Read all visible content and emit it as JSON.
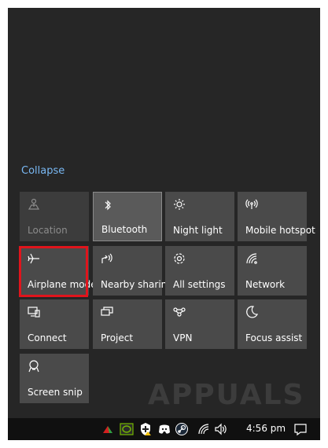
{
  "action_center": {
    "collapse_label": "Collapse",
    "tiles": [
      {
        "label": "Location",
        "icon": "location-icon",
        "state": "disabled"
      },
      {
        "label": "Bluetooth",
        "icon": "bluetooth-icon",
        "state": "on"
      },
      {
        "label": "Night light",
        "icon": "night-light-icon",
        "state": "off"
      },
      {
        "label": "Mobile hotspot",
        "icon": "mobile-hotspot-icon",
        "state": "off"
      },
      {
        "label": "Airplane mode",
        "icon": "airplane-icon",
        "state": "off"
      },
      {
        "label": "Nearby sharing",
        "icon": "nearby-sharing-icon",
        "state": "off"
      },
      {
        "label": "All settings",
        "icon": "gear-icon",
        "state": "off"
      },
      {
        "label": "Network",
        "icon": "network-icon",
        "state": "off"
      },
      {
        "label": "Connect",
        "icon": "connect-icon",
        "state": "off"
      },
      {
        "label": "Project",
        "icon": "project-icon",
        "state": "off"
      },
      {
        "label": "VPN",
        "icon": "vpn-icon",
        "state": "off"
      },
      {
        "label": "Focus assist",
        "icon": "moon-icon",
        "state": "off"
      },
      {
        "label": "Screen snip",
        "icon": "screen-snip-icon",
        "state": "off"
      }
    ]
  },
  "taskbar": {
    "clock": "4:56 pm",
    "tray_icons": [
      "show-hidden-icons-icon",
      "nvidia-icon",
      "security-warning-icon",
      "discord-icon",
      "steam-icon",
      "wifi-icon",
      "volume-icon"
    ],
    "notification_icon": "action-center-icon"
  },
  "watermark": "APPUALS",
  "colors": {
    "highlight": "#e0141c",
    "link": "#79b8f3",
    "tile": "#4a4a4a"
  }
}
